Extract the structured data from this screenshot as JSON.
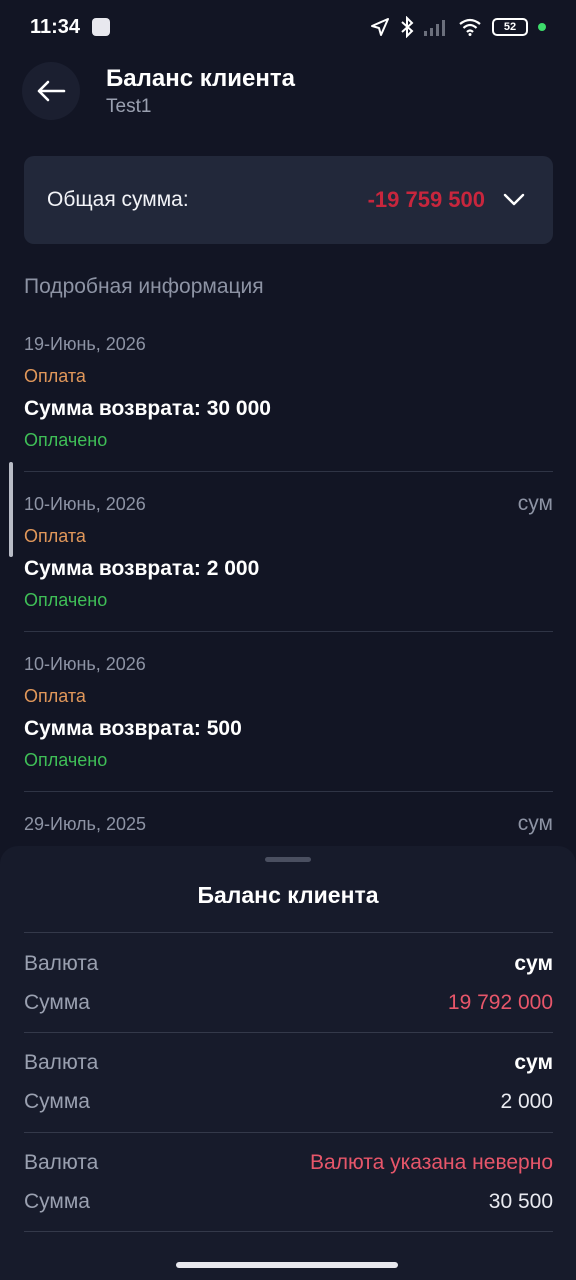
{
  "status_bar": {
    "time": "11:34",
    "battery": "52"
  },
  "header": {
    "title": "Баланс клиента",
    "subtitle": "Test1"
  },
  "total": {
    "label": "Общая сумма:",
    "value": "-19 759 500"
  },
  "section_title": "Подробная информация",
  "transactions": [
    {
      "date": "19-Июнь, 2026",
      "currency": "",
      "type": "Оплата",
      "amount": "Сумма возврата: 30 000",
      "status": "Оплачено"
    },
    {
      "date": "10-Июнь, 2026",
      "currency": "сум",
      "type": "Оплата",
      "amount": "Сумма возврата: 2 000",
      "status": "Оплачено"
    },
    {
      "date": "10-Июнь, 2026",
      "currency": "",
      "type": "Оплата",
      "amount": "Сумма возврата: 500",
      "status": "Оплачено"
    },
    {
      "date": "29-Июль, 2025",
      "currency": "сум"
    }
  ],
  "sheet": {
    "title": "Баланс клиента",
    "rows": [
      {
        "currency_label": "Валюта",
        "currency": "сум",
        "amount_label": "Сумма",
        "amount": "19 792 000"
      },
      {
        "currency_label": "Валюта",
        "currency": "сум",
        "amount_label": "Сумма",
        "amount": "2 000"
      },
      {
        "currency_label": "Валюта",
        "currency": "Валюта указана неверно",
        "amount_label": "Сумма",
        "amount": "30 500"
      }
    ]
  },
  "colors": {
    "negative": "#c8263d",
    "payment": "#e0975a",
    "paid": "#3fbf57"
  },
  "icons": [
    "back-arrow-icon",
    "chevron-down-icon",
    "location-icon",
    "bluetooth-icon",
    "signal-icon",
    "wifi-icon",
    "battery-icon"
  ]
}
